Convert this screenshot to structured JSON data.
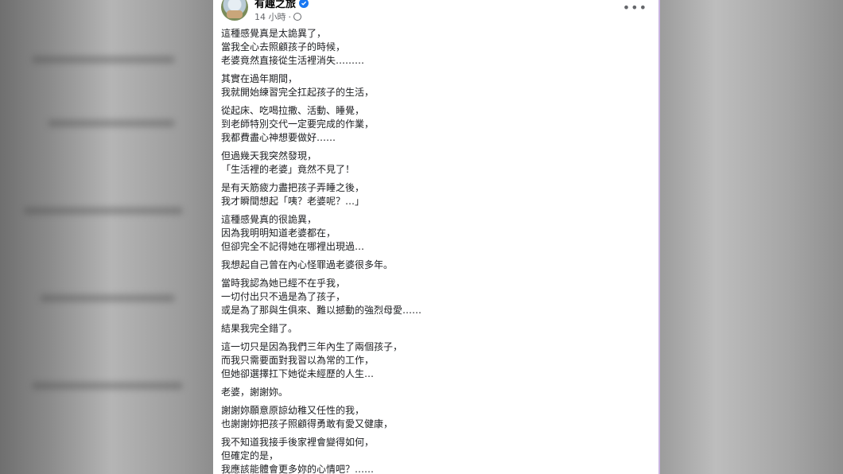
{
  "post": {
    "author": "有趣之旅",
    "timestamp": "14 小時",
    "separator": "·",
    "more_label": "•••",
    "paragraphs": [
      [
        "這種感覺真是太詭異了，",
        "當我全心去照顧孩子的時候，",
        "老婆竟然直接從生活裡消失………"
      ],
      [
        "其實在過年期間，",
        "我就開始練習完全扛起孩子的生活，"
      ],
      [
        "從起床、吃喝拉撒、活動、睡覺，",
        "到老師特別交代一定要完成的作業，",
        "我都費盡心神想要做好……"
      ],
      [
        "但過幾天我突然發現，",
        "「生活裡的老婆」竟然不見了！"
      ],
      [
        "是有天筋疲力盡把孩子弄睡之後，",
        "我才瞬間想起「咦？老婆呢？…」"
      ],
      [
        "這種感覺真的很詭異，",
        "因為我明明知道老婆都在，",
        "但卻完全不記得她在哪裡出現過…"
      ],
      [
        "我想起自己曾在內心怪罪過老婆很多年。"
      ],
      [
        "當時我認為她已經不在乎我，",
        "一切付出只不過是為了孩子，",
        "或是為了那與生俱來、難以撼動的強烈母愛……"
      ],
      [
        "結果我完全錯了。"
      ],
      [
        "這一切只是因為我們三年內生了兩個孩子，",
        "而我只需要面對我習以為常的工作，",
        "但她卻選擇扛下她從未經歷的人生…"
      ],
      [
        "老婆，謝謝妳。"
      ],
      [
        "謝謝妳願意原諒幼稚又任性的我，",
        "也謝謝妳把孩子照顧得勇敢有愛又健康，"
      ],
      [
        "我不知道我接手後家裡會變得如何，",
        "但確定的是，",
        "我應該能體會更多妳的心情吧？……"
      ]
    ]
  },
  "colors": {
    "verified": "#1877f2",
    "text": "#1c1e21",
    "meta": "#65676b",
    "accent_border": "#c8b3e0"
  },
  "icons": {
    "verified": "verified-badge-icon",
    "globe": "globe-icon",
    "more": "more-options-icon"
  }
}
